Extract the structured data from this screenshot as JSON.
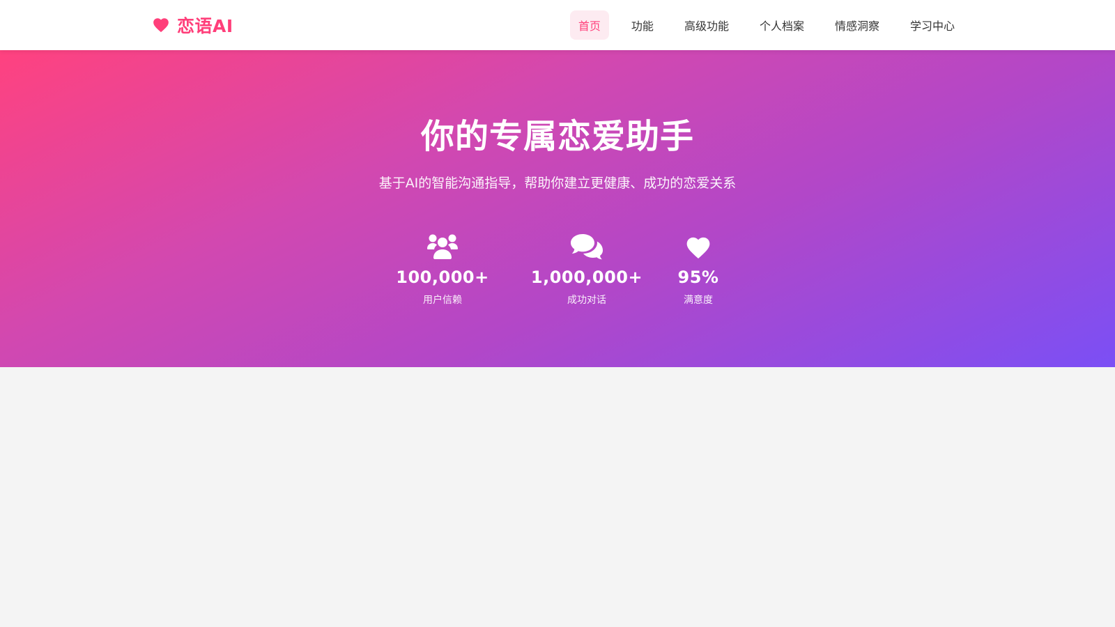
{
  "brand": {
    "name": "恋语AI",
    "icon": "heart-icon",
    "color": "#ff3f7a"
  },
  "nav": {
    "items": [
      {
        "label": "首页",
        "active": true
      },
      {
        "label": "功能",
        "active": false
      },
      {
        "label": "高级功能",
        "active": false
      },
      {
        "label": "个人档案",
        "active": false
      },
      {
        "label": "情感洞察",
        "active": false
      },
      {
        "label": "学习中心",
        "active": false
      }
    ],
    "active_color": "#ff3f7a",
    "active_bg": "#fdebf1"
  },
  "hero": {
    "title": "你的专属恋爱助手",
    "subtitle": "基于AI的智能沟通指导，帮助你建立更健康、成功的恋爱关系",
    "gradient": [
      "#ff427f",
      "#7b4ff5"
    ],
    "stats": [
      {
        "icon": "users-icon",
        "value": "100,000+",
        "label": "用户信赖"
      },
      {
        "icon": "chat-bubbles-icon",
        "value": "1,000,000+",
        "label": "成功对话"
      },
      {
        "icon": "heart-icon",
        "value": "95%",
        "label": "满意度"
      }
    ]
  },
  "page": {
    "background": "#f4f4f4"
  }
}
